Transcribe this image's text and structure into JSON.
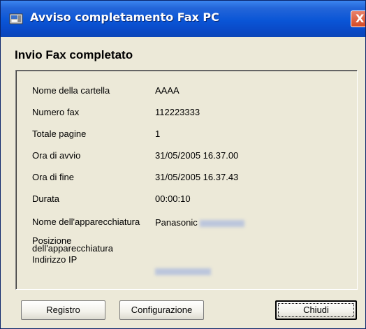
{
  "window": {
    "title": "Avviso completamento Fax PC",
    "close_glyph": "X"
  },
  "heading": "Invio Fax completato",
  "details": {
    "folder_name": {
      "label": "Nome della cartella",
      "value": "AAAA"
    },
    "fax_number": {
      "label": "Numero fax",
      "value": "112223333"
    },
    "total_pages": {
      "label": "Totale pagine",
      "value": "1"
    },
    "start_time": {
      "label": "Ora di avvio",
      "value": "31/05/2005 16.37.00"
    },
    "end_time": {
      "label": "Ora di fine",
      "value": "31/05/2005 16.37.43"
    },
    "duration": {
      "label": "Durata",
      "value": "00:00:10"
    },
    "device_name": {
      "label": "Nome dell'apparecchiatura",
      "value": "Panasonic"
    },
    "device_location": {
      "label": "Posizione dell'apparecchiatura"
    },
    "ip_address": {
      "label": "Indirizzo IP"
    }
  },
  "buttons": {
    "log": "Registro",
    "config": "Configurazione",
    "close": "Chiudi"
  },
  "colors": {
    "titlebar": "#0a55d6",
    "dialog_bg": "#ece9d8",
    "close_button": "#d44a25"
  }
}
